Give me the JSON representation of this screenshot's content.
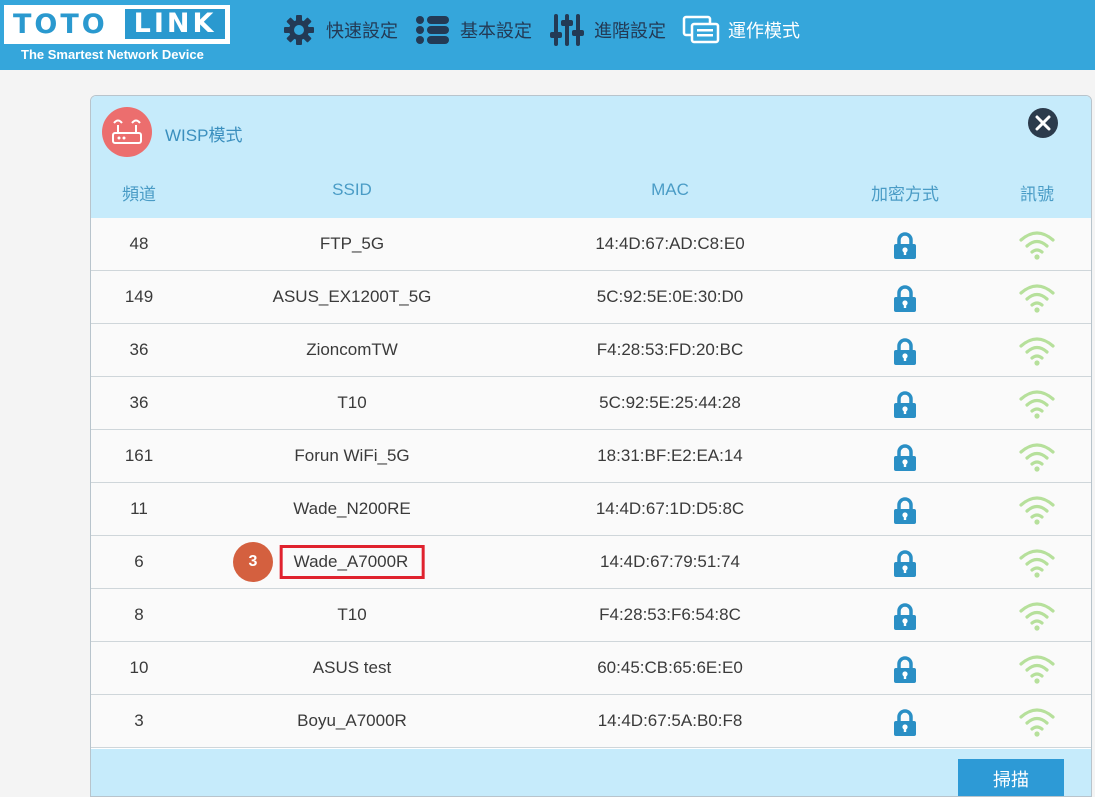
{
  "brand": {
    "logo_left": "TOTO",
    "logo_right": "LINK",
    "tagline": "The Smartest Network Device"
  },
  "nav": {
    "items": [
      {
        "label": "快速設定",
        "icon": "gear-icon",
        "active": false
      },
      {
        "label": "基本設定",
        "icon": "list-icon",
        "active": false
      },
      {
        "label": "進階設定",
        "icon": "sliders-icon",
        "active": false
      },
      {
        "label": "運作模式",
        "icon": "mode-icon",
        "active": true
      }
    ]
  },
  "dialog": {
    "title": "WISP模式",
    "columns": {
      "channel": "頻道",
      "ssid": "SSID",
      "mac": "MAC",
      "security": "加密方式",
      "signal": "訊號"
    },
    "rows": [
      {
        "channel": "48",
        "ssid": "FTP_5G",
        "mac": "14:4D:67:AD:C8:E0"
      },
      {
        "channel": "149",
        "ssid": "ASUS_EX1200T_5G",
        "mac": "5C:92:5E:0E:30:D0"
      },
      {
        "channel": "36",
        "ssid": "ZioncomTW",
        "mac": "F4:28:53:FD:20:BC"
      },
      {
        "channel": "36",
        "ssid": "T10",
        "mac": "5C:92:5E:25:44:28"
      },
      {
        "channel": "161",
        "ssid": "Forun WiFi_5G",
        "mac": "18:31:BF:E2:EA:14"
      },
      {
        "channel": "11",
        "ssid": "Wade_N200RE",
        "mac": "14:4D:67:1D:D5:8C"
      },
      {
        "channel": "6",
        "ssid": "Wade_A7000R",
        "mac": "14:4D:67:79:51:74"
      },
      {
        "channel": "8",
        "ssid": "T10",
        "mac": "F4:28:53:F6:54:8C"
      },
      {
        "channel": "10",
        "ssid": "ASUS test",
        "mac": "60:45:CB:65:6E:E0"
      },
      {
        "channel": "3",
        "ssid": "Boyu_A7000R",
        "mac": "14:4D:67:5A:B0:F8"
      }
    ],
    "highlighted_row": 6,
    "step_badge": "3",
    "scan_label": "掃描"
  },
  "colors": {
    "header_bg": "#35a6db",
    "panel_head_bg": "#c6ebfb",
    "lock": "#2a8fc5",
    "signal": "#b6e09b",
    "highlight_border": "#e0222e",
    "step_badge": "#d4603f"
  },
  "icons": {
    "row_security": "lock-icon",
    "row_signal": "wifi-signal-icon",
    "mode_badge": "router-icon",
    "close": "close-icon"
  }
}
